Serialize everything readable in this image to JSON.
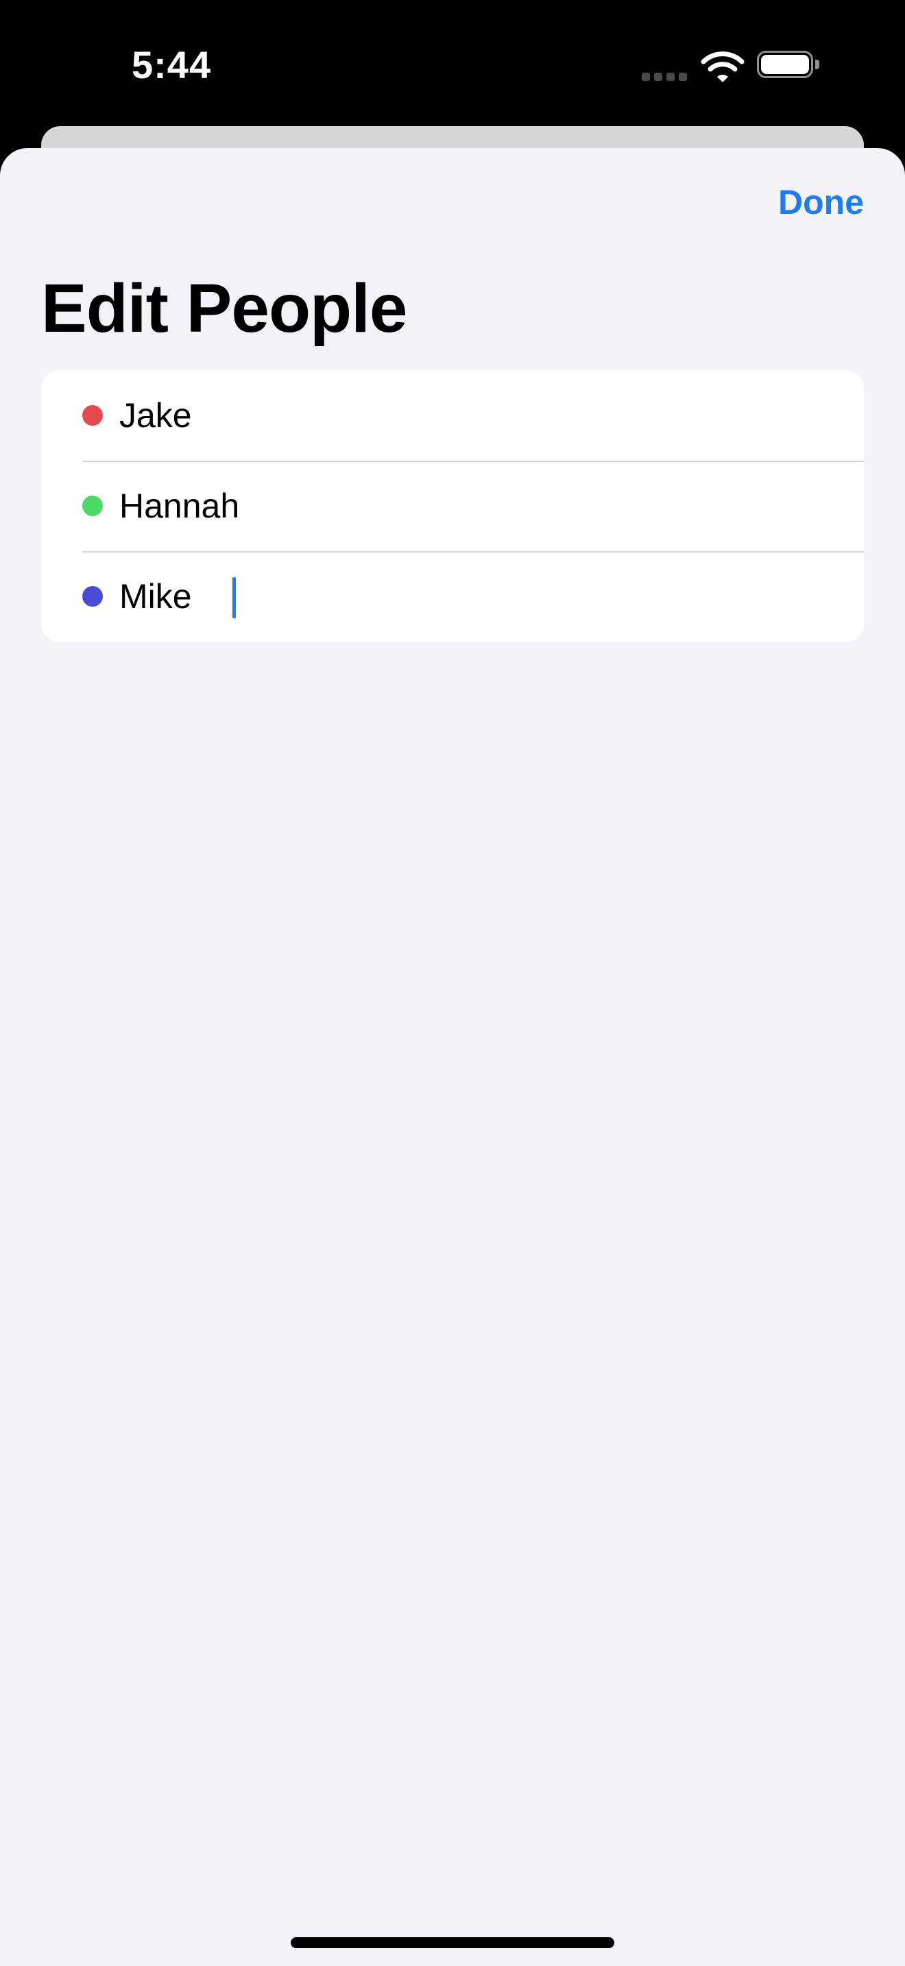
{
  "status_bar": {
    "time": "5:44"
  },
  "header": {
    "done_label": "Done",
    "title": "Edit People"
  },
  "people": [
    {
      "name": "Jake",
      "color": "#e5484d"
    },
    {
      "name": "Hannah",
      "color": "#4cd964"
    },
    {
      "name": "Mike",
      "color": "#4a4ad9"
    }
  ],
  "colors": {
    "accent": "#1f7cf0",
    "background": "#f2f2f7"
  },
  "icons": [
    "signal-icon",
    "wifi-icon",
    "battery-icon"
  ]
}
